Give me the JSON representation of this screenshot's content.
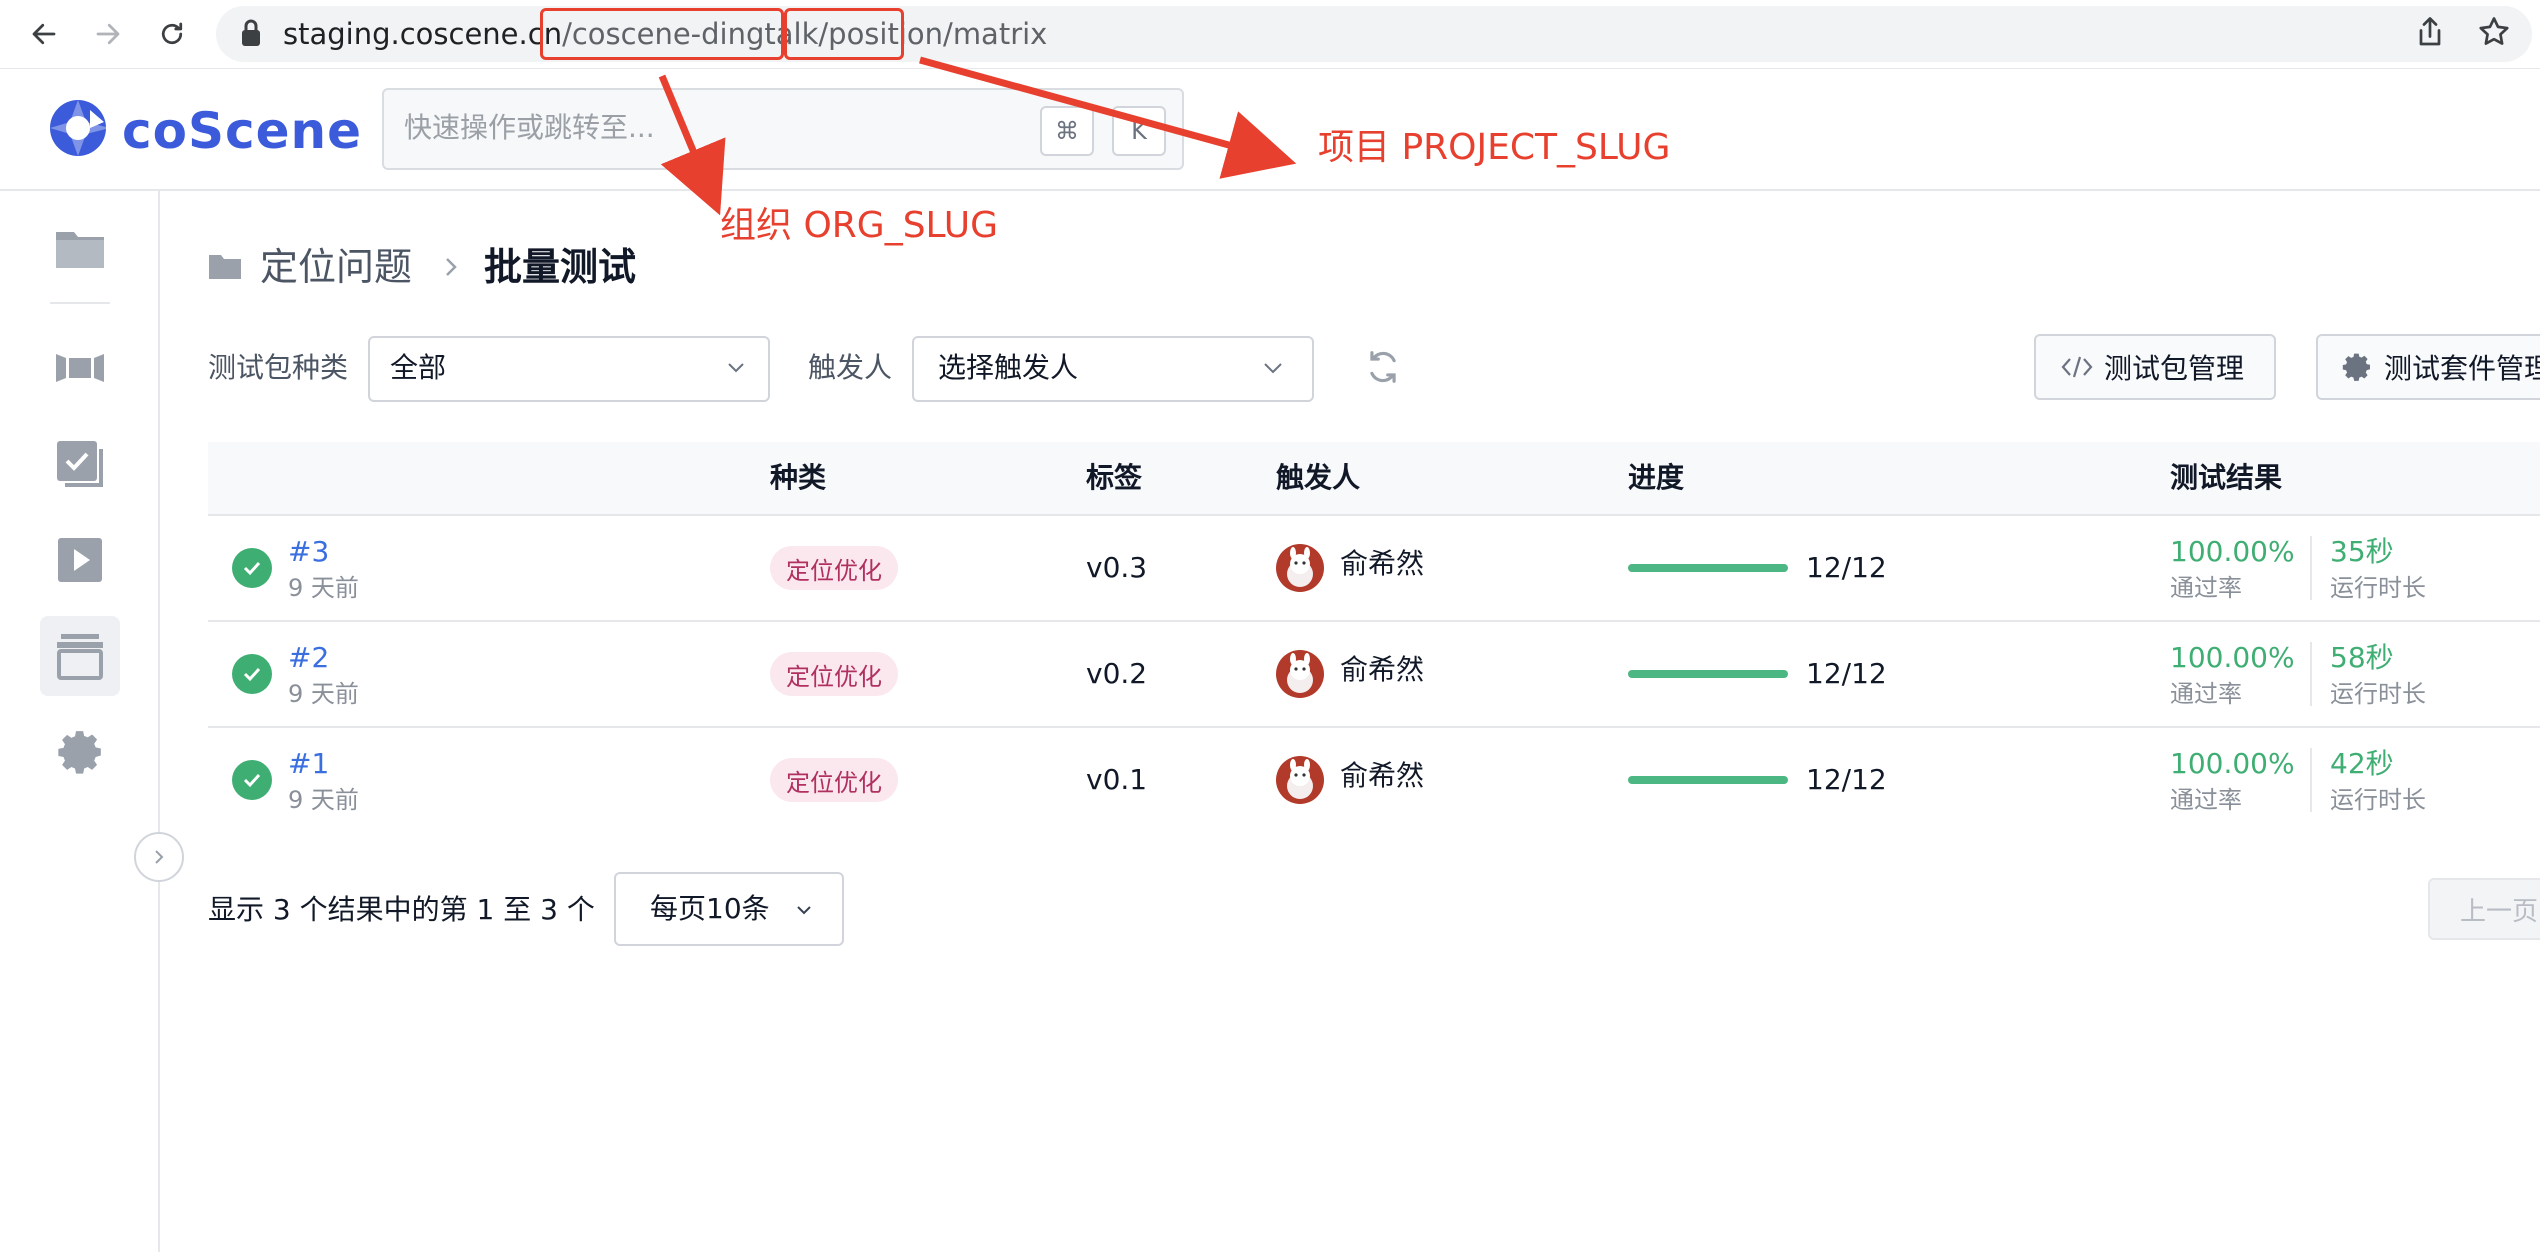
{
  "browser": {
    "url": {
      "host": "staging.coscene.cn",
      "sep1": "/",
      "org": "coscene-dingtalk",
      "sep2": "/",
      "project": "position",
      "sep3": "/",
      "path": "matrix"
    }
  },
  "header": {
    "logo_text": "coScene",
    "search_placeholder": "快速操作或跳转至...",
    "shortcut_keys": [
      "⌘",
      "K"
    ]
  },
  "annotations": {
    "org_label": "组织 ORG_SLUG",
    "project_label": "项目 PROJECT_SLUG",
    "color": "#e8402f"
  },
  "breadcrumb": {
    "parent": "定位问题",
    "current": "批量测试"
  },
  "filters": {
    "type_label": "测试包种类",
    "type_value": "全部",
    "trigger_label": "触发人",
    "trigger_placeholder": "选择触发人"
  },
  "actions": {
    "package_manage": "测试包管理",
    "suite_manage": "测试套件管理"
  },
  "table": {
    "columns": [
      "种类",
      "标签",
      "触发人",
      "进度",
      "测试结果"
    ],
    "rows": [
      {
        "id": "#3",
        "time": "9 天前",
        "kind": "定位优化",
        "tag": "v0.3",
        "user": "俞希然",
        "progress": 1.0,
        "progress_text": "12/12",
        "pass_rate": "100.00%",
        "pass_label": "通过率",
        "duration": "35秒",
        "duration_label": "运行时长"
      },
      {
        "id": "#2",
        "time": "9 天前",
        "kind": "定位优化",
        "tag": "v0.2",
        "user": "俞希然",
        "progress": 1.0,
        "progress_text": "12/12",
        "pass_rate": "100.00%",
        "pass_label": "通过率",
        "duration": "58秒",
        "duration_label": "运行时长"
      },
      {
        "id": "#1",
        "time": "9 天前",
        "kind": "定位优化",
        "tag": "v0.1",
        "user": "俞希然",
        "progress": 1.0,
        "progress_text": "12/12",
        "pass_rate": "100.00%",
        "pass_label": "通过率",
        "duration": "42秒",
        "duration_label": "运行时长"
      }
    ]
  },
  "pagination": {
    "summary": "显示 3 个结果中的第 1 至 3 个",
    "page_size": "每页10条",
    "prev": "上一页"
  },
  "colors": {
    "accent": "#3b5bdb",
    "success": "#3fae73",
    "link": "#3b6fe0",
    "tag_bg": "#fbe7ee",
    "tag_text": "#b03060"
  }
}
